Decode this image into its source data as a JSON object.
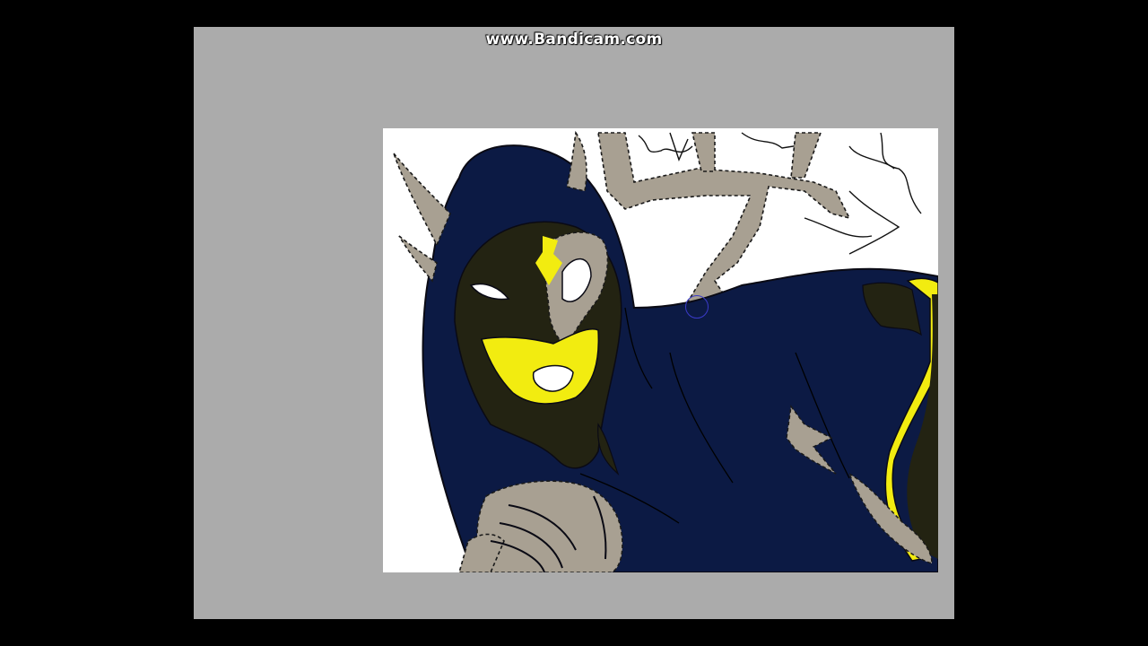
{
  "recorder": {
    "watermark_text": "www.Bandicam.com"
  },
  "colors": {
    "outer_background": "#000000",
    "workspace_gray": "#ababab",
    "canvas_white": "#ffffff",
    "cloak_navy": "#0c1a44",
    "face_dark": "#232312",
    "accent_yellow": "#f2ec10",
    "bone_gray": "#a8a092",
    "selection_marquee": "#1a1a1a"
  },
  "icons": {
    "brush_cursor": "circle-brush-cursor-icon"
  }
}
